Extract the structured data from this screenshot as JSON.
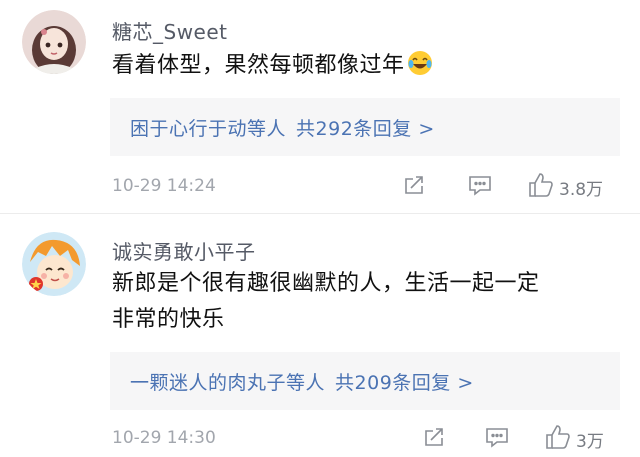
{
  "comments": [
    {
      "username": "糖芯_Sweet",
      "text": "看着体型，果然每顿都像过年",
      "text_emoji": "laughing-crying-emoji",
      "reply_users": "困于心行于动等人",
      "reply_count": "共292条回复 >",
      "timestamp": "10-29 14:24",
      "likes": "3.8万"
    },
    {
      "username": "诚实勇敢小平子",
      "text_line1": "新郎是个很有趣很幽默的人，生活一起一定",
      "text_line2": "非常的快乐",
      "reply_users": "一颗迷人的肉丸子等人",
      "reply_count": "共209条回复 >",
      "timestamp": "10-29 14:30",
      "likes": "3万"
    }
  ],
  "colors": {
    "link_blue": "#4b73b3",
    "meta_gray": "#a2a6ad",
    "reply_bg": "#f6f6f7"
  },
  "icons": [
    "share-icon",
    "comment-icon",
    "like-icon"
  ]
}
